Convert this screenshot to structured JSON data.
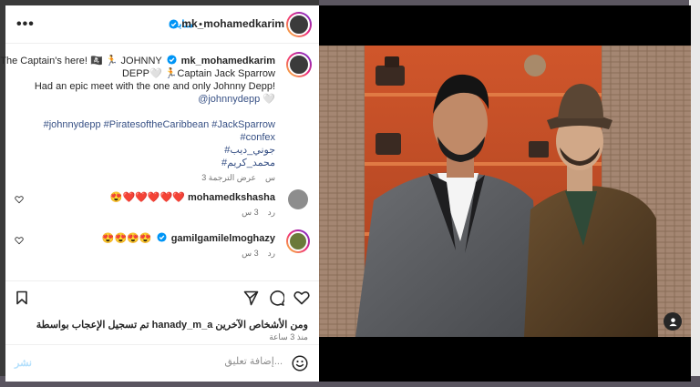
{
  "post": {
    "author": "mk_mohamedkarim",
    "follow_label": "متابعة",
    "more_label": "•••",
    "caption_lines": [
      "The Captain's here! 🏴‍☠️ 🏃 JOHNNY",
      "DEPP🤍 🏃Captain Jack Sparrow",
      "Had an epic meet with the one and only Johnny Depp!",
      "@johnnydepp 🤍"
    ],
    "caption_prefix_username": "mk_mohamedkarim",
    "hashtags": [
      "#johnnydepp #PiratesoftheCaribbean #JackSparrow",
      "#confex",
      "#جوني_ديب",
      "#محمد_كريم"
    ],
    "caption_time": "3 س",
    "translate_label": "عرض الترجمة"
  },
  "comments": [
    {
      "username": "mohamedkshasha",
      "text": "😍❤️❤️❤️❤️❤️",
      "time": "3 س",
      "reply_label": "رد"
    },
    {
      "username": "gamilgamilelmoghazy",
      "text": "😍😍😍😍",
      "time": "3 س",
      "reply_label": "رد"
    }
  ],
  "actions": {
    "likes_text": "تم تسجيل الإعجاب بواسطة hanady_m_a ومن الأشخاص الآخرين",
    "post_time": "منذ 3 ساعة"
  },
  "add_comment": {
    "placeholder": "إضافة تعليق...",
    "post_label": "نشر"
  },
  "colors": {
    "link": "#385185",
    "verified": "#0095f6",
    "follow": "#0095f6",
    "photo_bg": "#c8502a"
  },
  "icons": [
    "more-icon",
    "verified-icon",
    "heart-icon",
    "comment-icon",
    "share-icon",
    "save-icon",
    "emoji-icon",
    "user-tag-icon"
  ]
}
